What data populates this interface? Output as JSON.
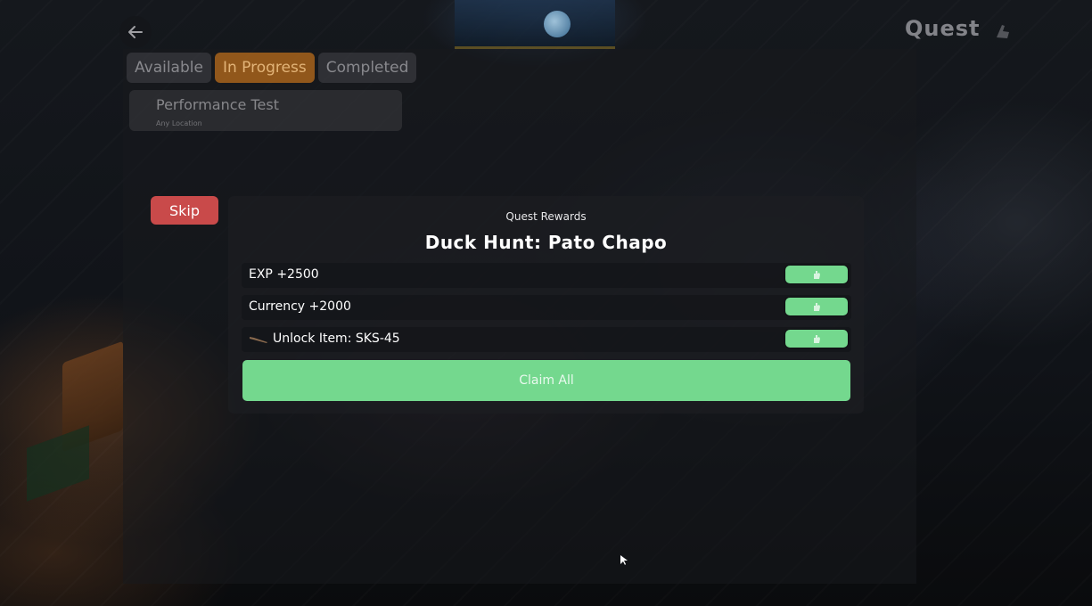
{
  "header": {
    "title": "Quest",
    "back_icon": "arrow-left-icon",
    "title_icon": "hand-pointer-icon"
  },
  "tabs": [
    {
      "label": "Available",
      "active": false
    },
    {
      "label": "In Progress",
      "active": true
    },
    {
      "label": "Completed",
      "active": false
    }
  ],
  "quest_list": [
    {
      "name": "Performance Test",
      "location": "Any Location"
    }
  ],
  "skip_label": "Skip",
  "rewards_dialog": {
    "kicker": "Quest Rewards",
    "quest_name": "Duck Hunt: Pato Chapo",
    "items": [
      {
        "label": "EXP +2500",
        "icon": null
      },
      {
        "label": "Currency +2000",
        "icon": null
      },
      {
        "label": "Unlock Item: SKS-45",
        "icon": "rifle-icon"
      }
    ],
    "claim_button_icon": "hand-icon",
    "claim_all_label": "Claim All"
  },
  "colors": {
    "claim_green": "#74d88e",
    "skip_red": "#c94a4a",
    "active_tab": "#b0681c"
  }
}
